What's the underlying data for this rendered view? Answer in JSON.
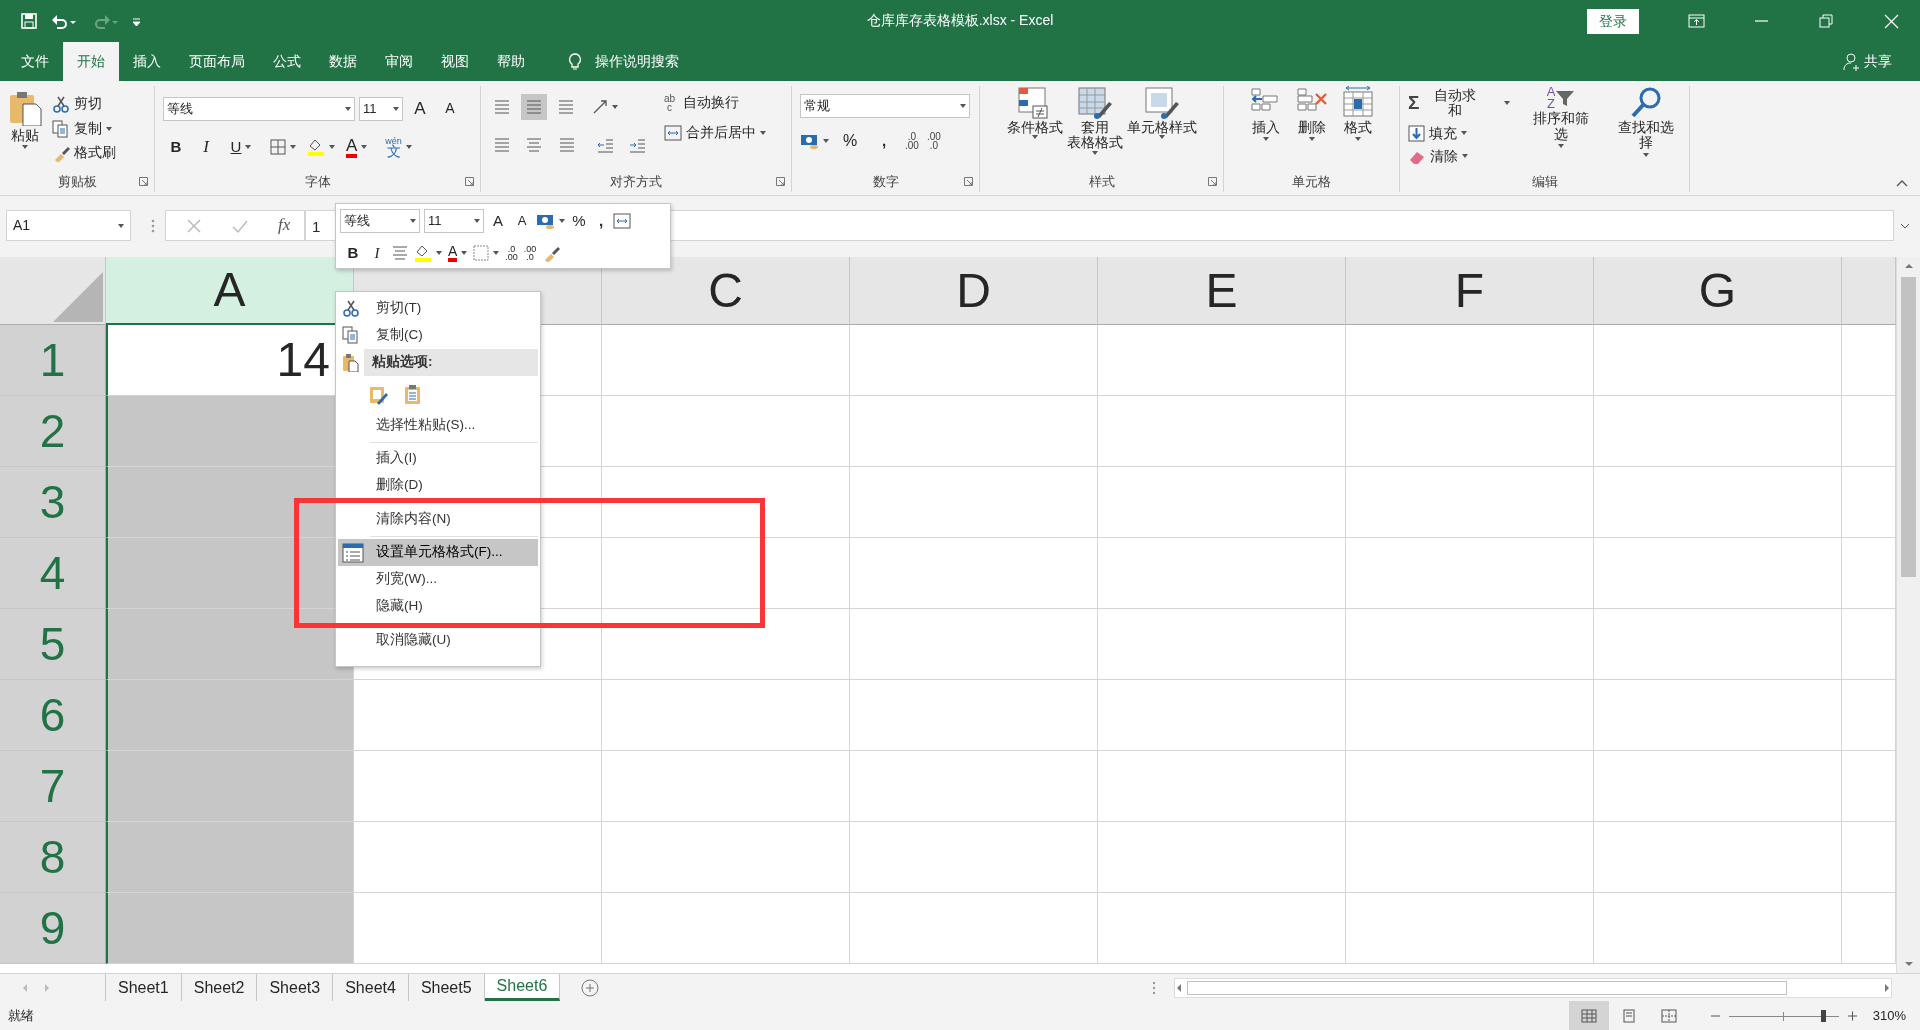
{
  "title_bar": {
    "title": "仓库库存表格模板.xlsx  -  Excel",
    "sign_in": "登录"
  },
  "ribbon_tabs": [
    {
      "label": "文件",
      "selected": false
    },
    {
      "label": "开始",
      "selected": true
    },
    {
      "label": "插入",
      "selected": false
    },
    {
      "label": "页面布局",
      "selected": false
    },
    {
      "label": "公式",
      "selected": false
    },
    {
      "label": "数据",
      "selected": false
    },
    {
      "label": "审阅",
      "selected": false
    },
    {
      "label": "视图",
      "selected": false
    },
    {
      "label": "帮助",
      "selected": false
    }
  ],
  "tell_me": "操作说明搜索",
  "share": "共享",
  "clipboard": {
    "title": "剪贴板",
    "paste": "粘贴",
    "cut": "剪切",
    "copy": "复制",
    "format_painter": "格式刷"
  },
  "font": {
    "title": "字体",
    "font_name": "等线",
    "font_size": "11",
    "grow": "A",
    "shrink": "A",
    "bold": "B",
    "italic": "I",
    "underline": "U",
    "font_color": "A",
    "phonetic": [
      "wén",
      "文"
    ]
  },
  "alignment": {
    "title": "对齐方式",
    "wrap_glyph": [
      "ab",
      "c"
    ],
    "wrap_text": "自动换行",
    "merge_center": "合并后居中"
  },
  "number": {
    "title": "数字",
    "format": "常规",
    "percent": "%",
    "comma": ",",
    "increase_decimal": [
      ".0",
      ".00"
    ],
    "decrease_decimal": [
      ".00",
      ".0"
    ]
  },
  "styles": {
    "title": "样式",
    "buttons": [
      {
        "lines": [
          "条件格式"
        ]
      },
      {
        "lines": [
          "套用",
          "表格格式"
        ]
      },
      {
        "lines": [
          "单元格样式"
        ]
      }
    ]
  },
  "cells": {
    "title": "单元格",
    "buttons": [
      {
        "label": "插入"
      },
      {
        "label": "删除"
      },
      {
        "label": "格式"
      }
    ]
  },
  "editing": {
    "title": "编辑",
    "sum_glyph": "Σ",
    "autosum": "自动求和",
    "fill": "填充",
    "clear": "清除",
    "sort_glyph": [
      "A",
      "Z"
    ],
    "sort_filter": "排序和筛选",
    "find_select": "查找和选择"
  },
  "formula_bar": {
    "name_box": "A1",
    "fx": "fx",
    "value": "1"
  },
  "mini_toolbar": {
    "font_name": "等线",
    "font_size": "11",
    "grow": "A",
    "shrink": "A",
    "percent": "%",
    "comma": ",",
    "bold": "B",
    "italic": "I",
    "font_color": "A",
    "increase_decimal": [
      ".0",
      ".00"
    ],
    "decrease_decimal": [
      ".00",
      ".0"
    ]
  },
  "context_menu": {
    "items": [
      {
        "kind": "cut",
        "label": "剪切(T)",
        "selected": false
      },
      {
        "kind": "copy",
        "label": "复制(C)",
        "selected": false
      },
      {
        "kind": "paste_header",
        "label": "粘贴选项:",
        "selected": false
      },
      {
        "kind": "paste_buttons"
      },
      {
        "kind": "command",
        "label": "选择性粘贴(S)...",
        "selected": false
      },
      {
        "kind": "separator"
      },
      {
        "kind": "command",
        "label": "插入(I)",
        "selected": false
      },
      {
        "kind": "command",
        "label": "删除(D)",
        "selected": false
      },
      {
        "kind": "command",
        "label": "清除内容(N)",
        "selected": false
      },
      {
        "kind": "separator"
      },
      {
        "kind": "format_cells",
        "label": "设置单元格格式(F)...",
        "selected": true
      },
      {
        "kind": "command",
        "label": "列宽(W)...",
        "selected": false
      },
      {
        "kind": "command",
        "label": "隐藏(H)",
        "selected": false
      },
      {
        "kind": "command",
        "label": "取消隐藏(U)",
        "selected": false
      }
    ]
  },
  "sheet": {
    "columns": [
      {
        "label": "A",
        "selected": true
      },
      {
        "selected": false
      },
      {
        "label": "C",
        "selected": false
      },
      {
        "label": "D",
        "selected": false
      },
      {
        "label": "E",
        "selected": false
      },
      {
        "label": "F",
        "selected": false
      },
      {
        "label": "G",
        "selected": false
      }
    ],
    "rows": [
      {
        "label": "1",
        "selected": true
      },
      {
        "label": "2",
        "selected": true
      },
      {
        "label": "3",
        "selected": true
      },
      {
        "label": "4",
        "selected": true
      },
      {
        "label": "5",
        "selected": true
      },
      {
        "label": "6",
        "selected": true
      },
      {
        "label": "7",
        "selected": true
      },
      {
        "label": "8",
        "selected": true
      },
      {
        "label": "9",
        "selected": true
      }
    ],
    "active_cell": {
      "value": "14"
    }
  },
  "sheet_tabs": [
    {
      "label": "Sheet1",
      "selected": false
    },
    {
      "label": "Sheet2",
      "selected": false
    },
    {
      "label": "Sheet3",
      "selected": false
    },
    {
      "label": "Sheet4",
      "selected": false
    },
    {
      "label": "Sheet5",
      "selected": false
    },
    {
      "label": "Sheet6",
      "selected": true
    }
  ],
  "status_bar": {
    "status": "就绪",
    "views": [
      {
        "selected": true
      },
      {
        "selected": false
      },
      {
        "selected": false
      }
    ],
    "zoom_slider": {
      "level": 0.88
    },
    "zoom_text": "310%"
  }
}
